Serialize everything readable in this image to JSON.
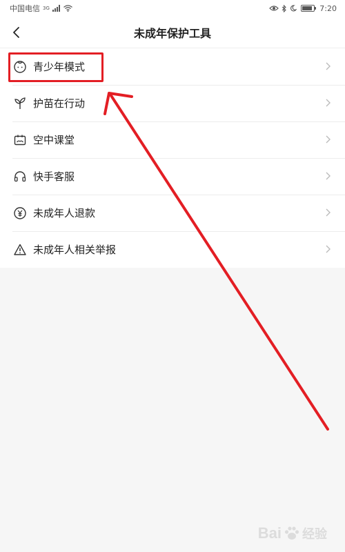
{
  "status_bar": {
    "carrier": "中国电信",
    "network": "3G",
    "time": "7:20",
    "battery_level": 0.85
  },
  "header": {
    "title": "未成年保护工具"
  },
  "menu": {
    "items": [
      {
        "label": "青少年模式",
        "icon": "child-face-icon"
      },
      {
        "label": "护苗在行动",
        "icon": "sprout-icon"
      },
      {
        "label": "空中课堂",
        "icon": "classroom-icon"
      },
      {
        "label": "快手客服",
        "icon": "headset-icon"
      },
      {
        "label": "未成年人退款",
        "icon": "refund-icon"
      },
      {
        "label": "未成年人相关举报",
        "icon": "warning-icon"
      }
    ]
  },
  "annotation": {
    "color": "#e31e24",
    "highlighted_item": "青少年模式"
  },
  "watermark": {
    "brand": "Bai",
    "suffix": "经验"
  },
  "colors": {
    "background": "#f6f6f6",
    "surface": "#ffffff",
    "text": "#222222",
    "chevron": "#bbbbbb",
    "annotation": "#e31e24"
  }
}
